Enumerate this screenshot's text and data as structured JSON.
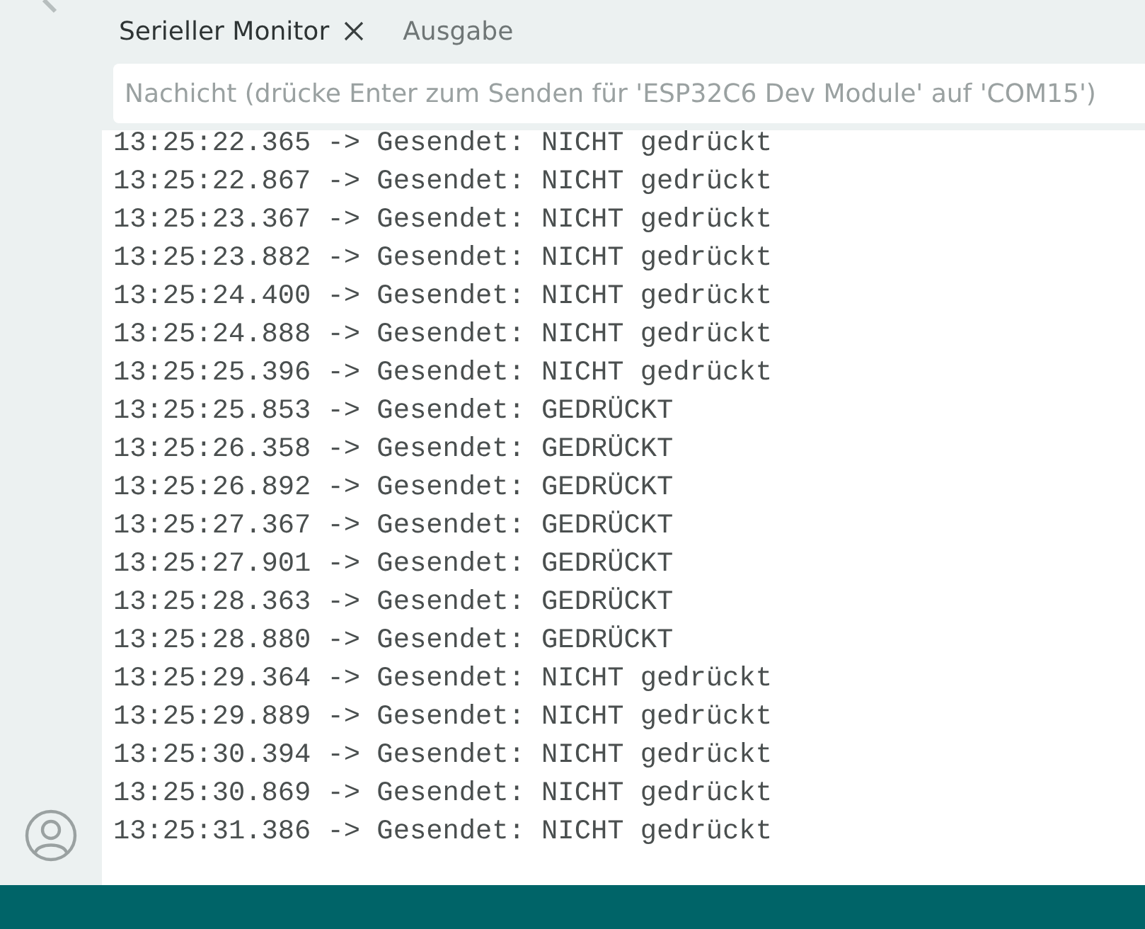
{
  "tabs": [
    {
      "label": "Serieller Monitor",
      "selected": true,
      "closable": true
    },
    {
      "label": "Ausgabe",
      "selected": false,
      "closable": false
    }
  ],
  "message_field": {
    "placeholder": "Nachicht (drücke Enter zum Senden für 'ESP32C6 Dev Module' auf 'COM15')"
  },
  "output_lines": [
    "13:25:22.365 -> Gesendet: NICHT gedrückt",
    "13:25:22.867 -> Gesendet: NICHT gedrückt",
    "13:25:23.367 -> Gesendet: NICHT gedrückt",
    "13:25:23.882 -> Gesendet: NICHT gedrückt",
    "13:25:24.400 -> Gesendet: NICHT gedrückt",
    "13:25:24.888 -> Gesendet: NICHT gedrückt",
    "13:25:25.396 -> Gesendet: NICHT gedrückt",
    "13:25:25.853 -> Gesendet: GEDRÜCKT",
    "13:25:26.358 -> Gesendet: GEDRÜCKT",
    "13:25:26.892 -> Gesendet: GEDRÜCKT",
    "13:25:27.367 -> Gesendet: GEDRÜCKT",
    "13:25:27.901 -> Gesendet: GEDRÜCKT",
    "13:25:28.363 -> Gesendet: GEDRÜCKT",
    "13:25:28.880 -> Gesendet: GEDRÜCKT",
    "13:25:29.364 -> Gesendet: NICHT gedrückt",
    "13:25:29.889 -> Gesendet: NICHT gedrückt",
    "13:25:30.394 -> Gesendet: NICHT gedrückt",
    "13:25:30.869 -> Gesendet: NICHT gedrückt",
    "13:25:31.386 -> Gesendet: NICHT gedrückt"
  ]
}
